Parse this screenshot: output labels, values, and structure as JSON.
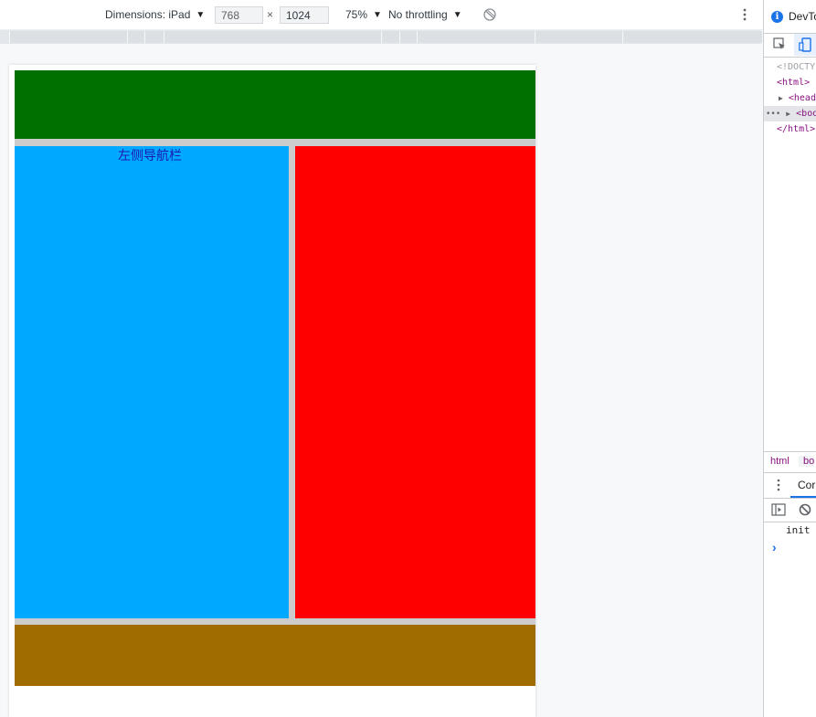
{
  "toolbar": {
    "dimensions_label": "Dimensions: iPad",
    "width_value": "768",
    "times": "×",
    "height_value": "1024",
    "zoom_label": "75%",
    "throttling_label": "No throttling",
    "rotate_icon": "rotate-icon",
    "more_icon": "more-vert-icon"
  },
  "page": {
    "left_nav_text": "左侧导航栏",
    "colors": {
      "header": "#007000",
      "left_nav": "#00a8ff",
      "main": "#ff0000",
      "footer": "#a06c00",
      "gutter": "#cccccc"
    }
  },
  "devtools": {
    "title": "DevTo",
    "dom": {
      "doctype": "<!DOCTY",
      "html_open": "<html>",
      "head": "<head",
      "body": "<body",
      "html_close": "</html>"
    },
    "breadcrumb": [
      "html",
      "bo"
    ],
    "drawer_tab": "Cor",
    "console_lines": [
      "init"
    ],
    "prompt": "›"
  }
}
